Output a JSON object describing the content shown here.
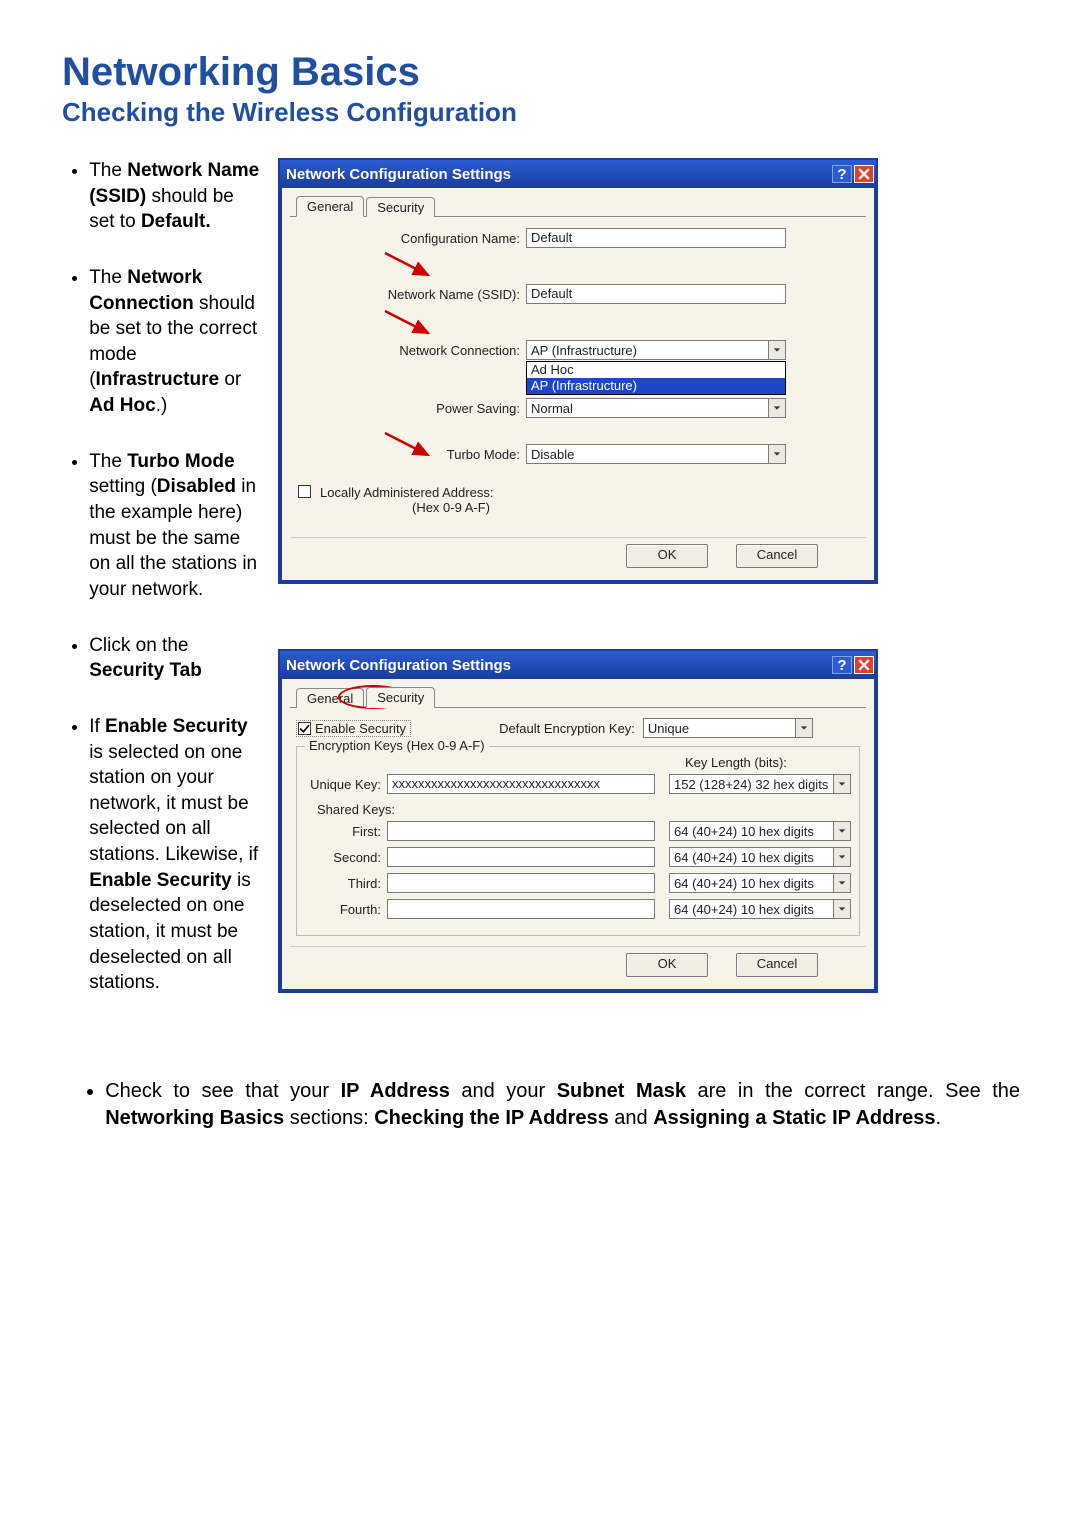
{
  "headings": {
    "main": "Networking Basics",
    "sub": "Checking the Wireless Configuration"
  },
  "bullets": {
    "b1": {
      "t1": "The ",
      "t2": "Network Name (SSID)",
      "t3": " should be set to ",
      "t4": "Default."
    },
    "b2": {
      "t1": "The ",
      "t2": "Network Connection",
      "t3": " should be set to the correct mode (",
      "t4": "Infrastructure",
      "t5": " or ",
      "t6": "Ad Hoc",
      "t7": ".)"
    },
    "b3": {
      "t1": "The ",
      "t2": "Turbo Mode",
      "t3": " setting (",
      "t4": "Disabled",
      "t5": " in the example here) must be the same on all the stations in your network."
    },
    "b4": {
      "t1": "Click on the ",
      "t2": "Security Tab"
    },
    "b5": {
      "t1": "If ",
      "t2": "Enable Security",
      "t3": " is selected on one station on your network, it must be selected on all stations.  Likewise, if ",
      "t4": "Enable Security",
      "t5": " is deselected on one station, it must be deselected on all stations."
    },
    "b6": {
      "t1": "Check to see that your ",
      "t2": "IP Address",
      "t3": " and your ",
      "t4": "Subnet Mask",
      "t5": " are in the correct range.  See the ",
      "t6": "Networking Basics",
      "t7": " sections: ",
      "t8": "Checking the IP Address",
      "t9": " and ",
      "t10": "Assigning a Static IP Address",
      "t11": "."
    }
  },
  "dialog1": {
    "title": "Network Configuration Settings",
    "tabs": {
      "general": "General",
      "security": "Security"
    },
    "labels": {
      "cfgname": "Configuration Name:",
      "ssid": "Network Name (SSID):",
      "conn": "Network Connection:",
      "power": "Power Saving:",
      "turbo": "Turbo Mode:",
      "laa1": "Locally Administered Address:",
      "laa2": "(Hex 0-9 A-F)"
    },
    "values": {
      "cfgname": "Default",
      "ssid": "Default",
      "conn": "AP (Infrastructure)",
      "power": "Normal",
      "turbo": "Disable"
    },
    "conn_options": {
      "o1": "Ad Hoc",
      "o2": "AP (Infrastructure)"
    },
    "buttons": {
      "ok": "OK",
      "cancel": "Cancel"
    }
  },
  "dialog2": {
    "title": "Network Configuration Settings",
    "tabs": {
      "general": "General",
      "security": "Security"
    },
    "enable_security": "Enable Security",
    "def_key_lbl": "Default Encryption Key:",
    "def_key_val": "Unique",
    "fieldset_legend": "Encryption Keys (Hex 0-9 A-F)",
    "key_length_header": "Key Length (bits):",
    "rows": {
      "unique": {
        "label": "Unique Key:",
        "value": "xxxxxxxxxxxxxxxxxxxxxxxxxxxxxxxx",
        "len": "152 (128+24) 32 hex digits"
      },
      "shared_lbl": "Shared Keys:",
      "first": {
        "label": "First:",
        "value": "",
        "len": "64  (40+24)  10 hex digits"
      },
      "second": {
        "label": "Second:",
        "value": "",
        "len": "64  (40+24)  10 hex digits"
      },
      "third": {
        "label": "Third:",
        "value": "",
        "len": "64  (40+24)  10 hex digits"
      },
      "fourth": {
        "label": "Fourth:",
        "value": "",
        "len": "64  (40+24)  10 hex digits"
      }
    },
    "buttons": {
      "ok": "OK",
      "cancel": "Cancel"
    }
  }
}
